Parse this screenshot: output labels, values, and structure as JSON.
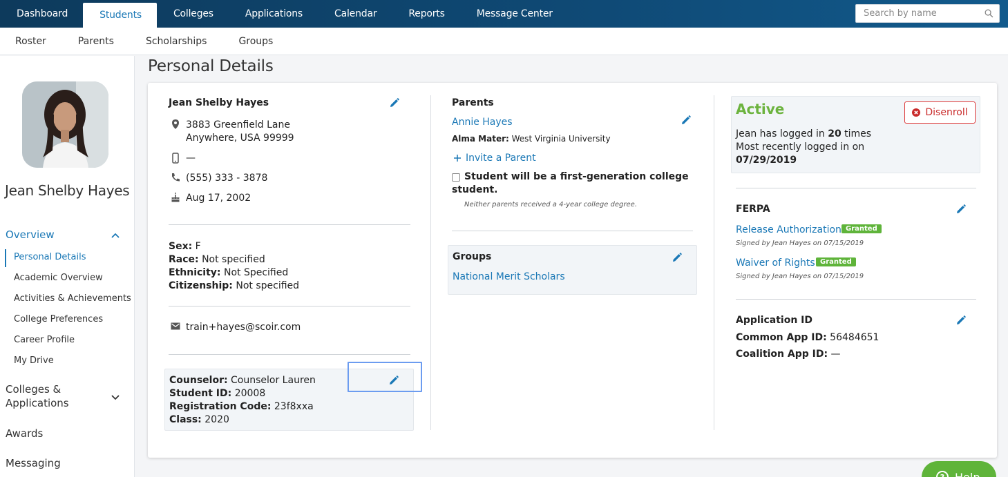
{
  "nav": {
    "tabs": [
      "Dashboard",
      "Students",
      "Colleges",
      "Applications",
      "Calendar",
      "Reports",
      "Message Center"
    ],
    "active_tab": "Students",
    "search_placeholder": "Search by name"
  },
  "subnav": [
    "Roster",
    "Parents",
    "Scholarships",
    "Groups"
  ],
  "sidebar": {
    "student_name": "Jean Shelby Hayes",
    "overview_label": "Overview",
    "overview_items": [
      "Personal Details",
      "Academic Overview",
      "Activities & Achievements",
      "College Preferences",
      "Career Profile",
      "My Drive"
    ],
    "active_item": "Personal Details",
    "colleges_label_1": "Colleges &",
    "colleges_label_2": "Applications",
    "awards_label": "Awards",
    "messaging_label": "Messaging"
  },
  "page_title": "Personal Details",
  "student": {
    "name": "Jean Shelby Hayes",
    "address_line1": "3883 Greenfield Lane",
    "address_line2": "Anywhere, USA 99999",
    "mobile": "—",
    "phone": "(555) 333 - 3878",
    "birthday": "Aug 17, 2002",
    "sex_label": "Sex:",
    "sex": "F",
    "race_label": "Race:",
    "race": "Not specified",
    "ethnicity_label": "Ethnicity:",
    "ethnicity": "Not Specified",
    "citizenship_label": "Citizenship:",
    "citizenship": "Not specified",
    "email": "train+hayes@scoir.com",
    "counselor_label": "Counselor:",
    "counselor": "Counselor Lauren",
    "student_id_label": "Student ID:",
    "student_id": "20008",
    "reg_code_label": "Registration Code:",
    "reg_code": "23f8xxa",
    "class_label": "Class:",
    "class": "2020"
  },
  "parents": {
    "heading": "Parents",
    "parent_name": "Annie Hayes",
    "alma_mater_label": "Alma Mater:",
    "alma_mater": "West Virginia University",
    "invite_label": "Invite a Parent",
    "first_gen_label_1": "Student will be a first-generation college",
    "first_gen_label_2": "student.",
    "first_gen_note": "Neither parents received a 4-year college degree."
  },
  "groups": {
    "heading": "Groups",
    "group_name": "National Merit Scholars"
  },
  "status": {
    "label": "Active",
    "disenroll_label": "Disenroll",
    "login_prefix": "Jean has logged in ",
    "login_count": "20",
    "login_suffix": " times",
    "recent_label": "Most recently logged in on",
    "recent_date": "07/29/2019"
  },
  "ferpa": {
    "heading": "FERPA",
    "release_label": "Release Authorization",
    "release_badge": "Granted",
    "release_signed": "Signed by Jean Hayes on 07/15/2019",
    "waiver_label": "Waiver of Rights",
    "waiver_badge": "Granted",
    "waiver_signed": "Signed by Jean Hayes on 07/15/2019"
  },
  "application_id": {
    "heading": "Application ID",
    "common_label": "Common App ID:",
    "common": "56484651",
    "coalition_label": "Coalition App ID:",
    "coalition": "—"
  },
  "help_label": "Help",
  "colors": {
    "nav_dark": "#0d3a5c",
    "link": "#1a78b6",
    "active_green": "#6cb33e",
    "badge_green": "#5fb43a",
    "danger": "#c92a2a"
  }
}
